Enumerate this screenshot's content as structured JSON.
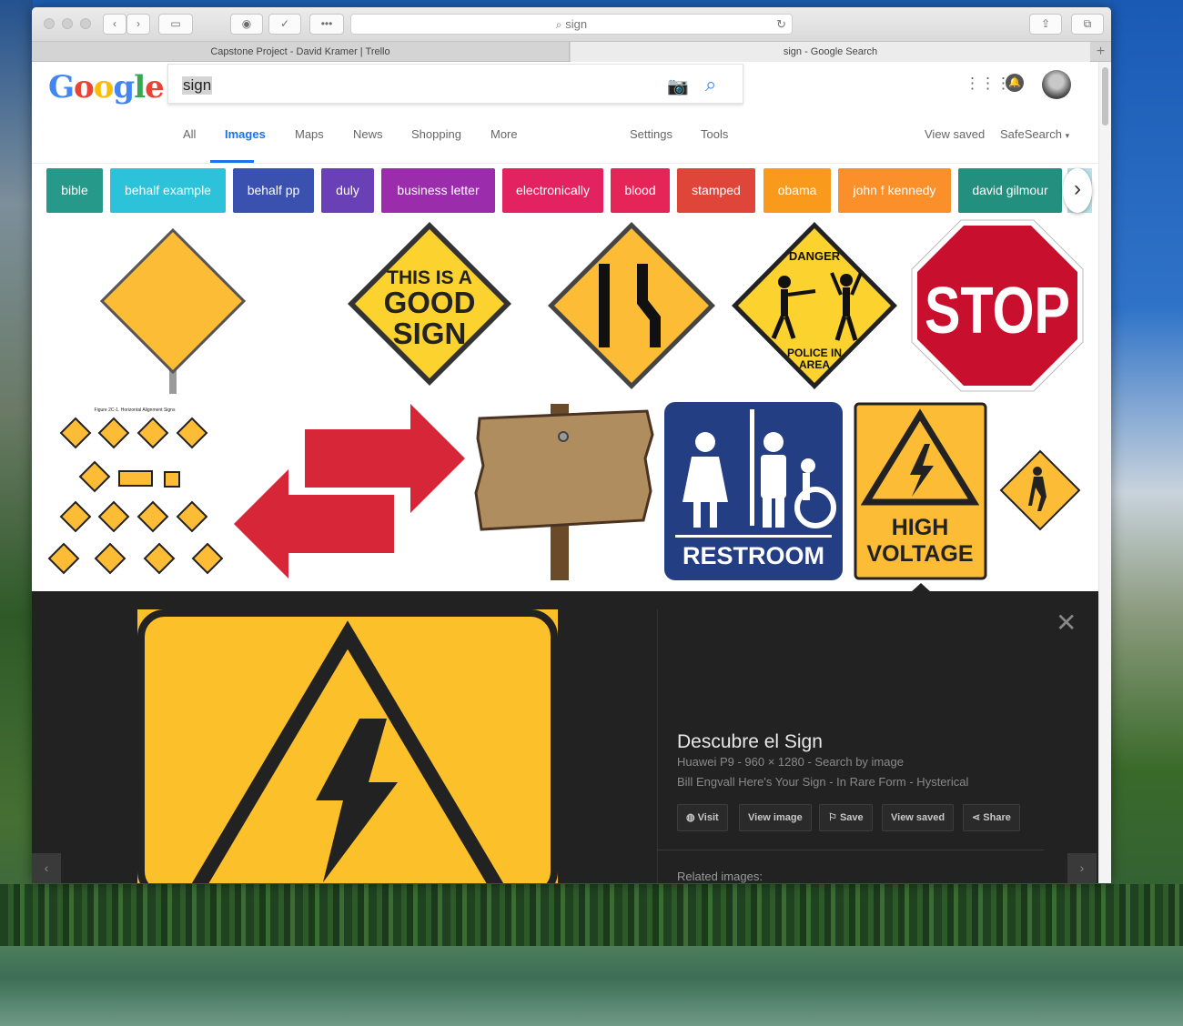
{
  "browser": {
    "address": "sign",
    "tabs": [
      "Capstone Project - David Kramer | Trello",
      "sign - Google Search"
    ]
  },
  "google": {
    "query": "sign",
    "nav": [
      "All",
      "Images",
      "Maps",
      "News",
      "Shopping",
      "More",
      "Settings",
      "Tools"
    ],
    "view_saved": "View saved",
    "safesearch": "SafeSearch"
  },
  "chips": [
    {
      "label": "bible",
      "color": "#26998a"
    },
    {
      "label": "behalf example",
      "color": "#2cc3da"
    },
    {
      "label": "behalf pp",
      "color": "#3b51b0"
    },
    {
      "label": "duly",
      "color": "#6a40b6"
    },
    {
      "label": "business letter",
      "color": "#9b2dad"
    },
    {
      "label": "electronically",
      "color": "#e32262"
    },
    {
      "label": "blood",
      "color": "#e52457"
    },
    {
      "label": "stamped",
      "color": "#e0453a"
    },
    {
      "label": "obama",
      "color": "#fa9a1d"
    },
    {
      "label": "john f kennedy",
      "color": "#fb8f2a"
    },
    {
      "label": "david gilmour",
      "color": "#23907f"
    }
  ],
  "images": {
    "good_sign": [
      "THIS IS A",
      "GOOD",
      "SIGN"
    ],
    "danger": [
      "DANGER",
      "POLICE IN",
      "AREA"
    ],
    "stop": "STOP",
    "figure_caption": "Figure 2C-1. Horizontal Alignment Signs",
    "restroom": "RESTROOM",
    "high_voltage": [
      "HIGH",
      "VOLTAGE"
    ]
  },
  "panel": {
    "title": "Descubre el Sign",
    "meta": "Huawei P9  -  960 × 1280  -  Search by image",
    "caption": "Bill Engvall Here's Your Sign - In Rare Form - Hysterical",
    "buttons": [
      "Visit",
      "View image",
      "Save",
      "View saved",
      "Share"
    ],
    "related": "Related images:"
  }
}
